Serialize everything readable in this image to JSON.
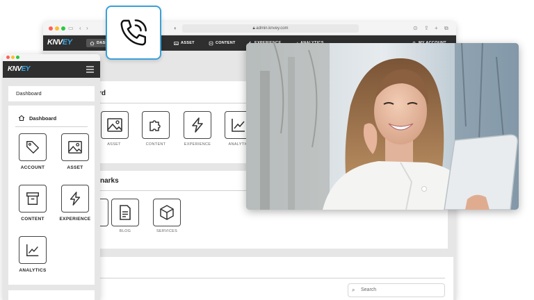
{
  "browser": {
    "url": "admin.knvey.com",
    "logo": {
      "main": "KNV",
      "accent": "EY"
    },
    "nav": [
      {
        "label": "DASHBOARD",
        "icon": "home-icon"
      },
      {
        "label": "ASSET",
        "icon": "image-icon"
      },
      {
        "label": "CONTENT",
        "icon": "content-icon"
      },
      {
        "label": "EXPERIENCE",
        "icon": "bolt-icon"
      },
      {
        "label": "ANALYTICS",
        "icon": "analytics-icon"
      },
      {
        "label": "MY ACCOUNT",
        "icon": "user-icon"
      }
    ]
  },
  "dashboard_panel": {
    "title": "rd",
    "tiles": [
      {
        "label": "ASSET",
        "icon": "image-icon"
      },
      {
        "label": "CONTENT",
        "icon": "puzzle-icon"
      },
      {
        "label": "EXPERIENCE",
        "icon": "bolt-icon"
      },
      {
        "label": "ANALYTIC",
        "icon": "analytics-icon"
      }
    ]
  },
  "bookmarks_panel": {
    "title": "narks",
    "tiles": [
      {
        "label": "",
        "icon": "blank-icon"
      },
      {
        "label": "BLOG",
        "icon": "document-icon"
      },
      {
        "label": "SERVICES",
        "icon": "box-icon"
      }
    ]
  },
  "search": {
    "placeholder": "Search"
  },
  "mobile": {
    "logo": {
      "main": "KNV",
      "accent": "EY"
    },
    "breadcrumb": "Dashboard",
    "section_title": "Dashboard",
    "tiles": [
      {
        "label": "ACCOUNT",
        "icon": "tag-icon"
      },
      {
        "label": "ASSET",
        "icon": "image-icon"
      },
      {
        "label": "CONTENT",
        "icon": "archive-icon"
      },
      {
        "label": "EXPERIENCE",
        "icon": "bolt-icon"
      },
      {
        "label": "ANALYTICS",
        "icon": "analytics-icon"
      }
    ]
  },
  "colors": {
    "accent": "#3aa0d8",
    "navbar": "#2f2f2f",
    "background": "#e6e6e6"
  }
}
